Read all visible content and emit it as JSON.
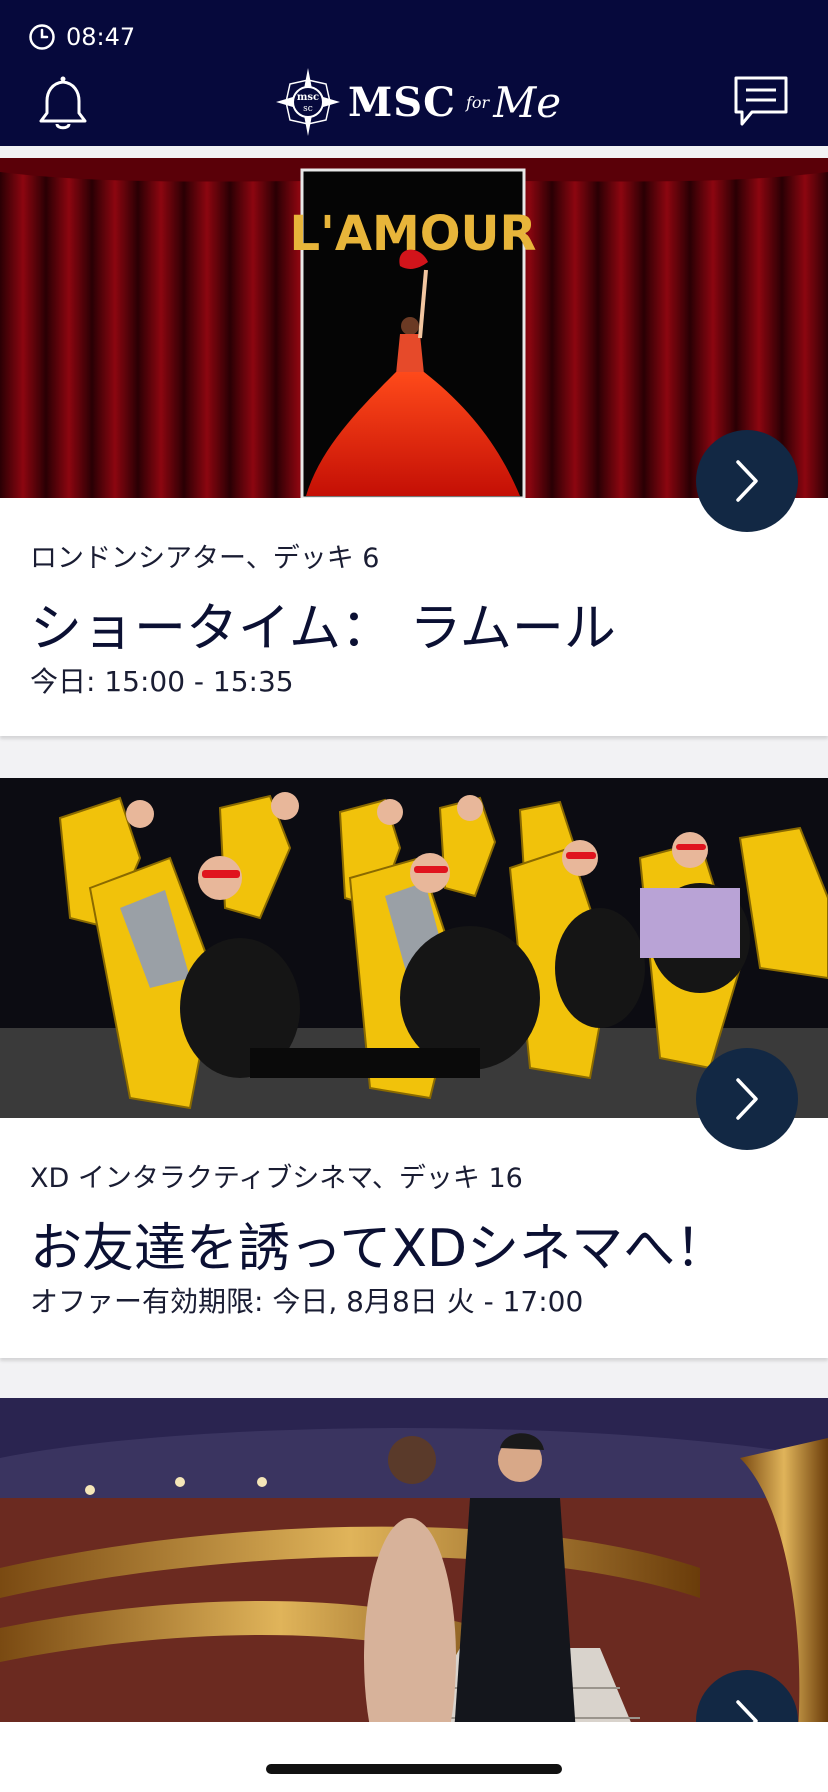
{
  "status_bar": {
    "time": "08:47",
    "clock_icon": "clock-icon"
  },
  "header": {
    "logo_text": "MSC",
    "logo_script": "for",
    "logo_me": "Me",
    "left_icon": "bell-icon",
    "right_icon": "chat-icon",
    "background": "#06093c"
  },
  "cards": [
    {
      "poster_title": "L'AMOUR",
      "venue": "ロンドンシアター、デッキ 6",
      "title": "ショータイム： ラムール",
      "time": "今日: 15:00 - 15:35"
    },
    {
      "venue": "XD インタラクティブシネマ、デッキ 16",
      "title": "お友達を誘ってXDシネマへ！",
      "time": "オファー有効期限: 今日, 8月8日 火 - 17:00"
    },
    {
      "venue": "",
      "title": "",
      "time": ""
    }
  ],
  "colors": {
    "accent": "#122844",
    "card_bg": "#ffffff",
    "page_bg": "#f2f2f4"
  }
}
